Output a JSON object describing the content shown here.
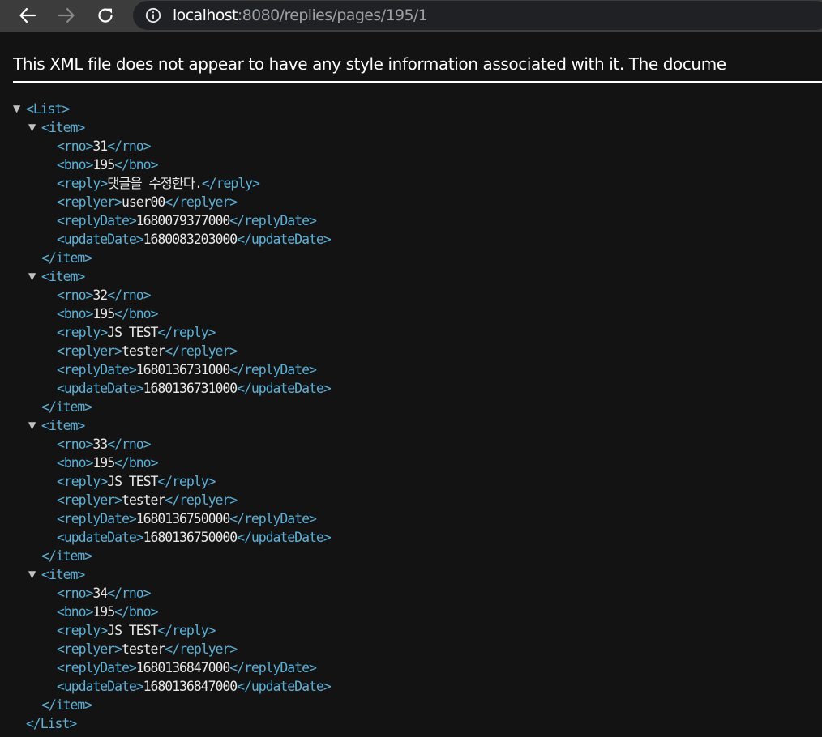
{
  "browser": {
    "url_host": "localhost",
    "url_rest": ":8080/replies/pages/195/1"
  },
  "xml_viewer": {
    "notice": "This XML file does not appear to have any style information associated with it. The docume",
    "root_tag": "List",
    "item_tag": "item",
    "toggle_glyph": "▼",
    "items": [
      {
        "rno": "31",
        "bno": "195",
        "reply": "댓글을 수정한다.",
        "replyer": "user00",
        "replyDate": "1680079377000",
        "updateDate": "1680083203000"
      },
      {
        "rno": "32",
        "bno": "195",
        "reply": "JS TEST",
        "replyer": "tester",
        "replyDate": "1680136731000",
        "updateDate": "1680136731000"
      },
      {
        "rno": "33",
        "bno": "195",
        "reply": "JS TEST",
        "replyer": "tester",
        "replyDate": "1680136750000",
        "updateDate": "1680136750000"
      },
      {
        "rno": "34",
        "bno": "195",
        "reply": "JS TEST",
        "replyer": "tester",
        "replyDate": "1680136847000",
        "updateDate": "1680136847000"
      }
    ]
  },
  "colors": {
    "tag": "#5db0d7",
    "value": "#e8e8e8",
    "background": "#131313",
    "toolbar": "#3c3c3c",
    "omnibox": "#202124"
  }
}
